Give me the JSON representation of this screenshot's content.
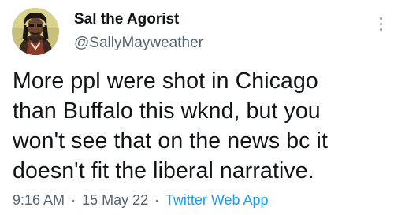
{
  "author": {
    "name": "Sal the Agorist",
    "handle": "@SallyMayweather"
  },
  "tweet": {
    "lines": [
      "More ppl were shot in Chicago",
      "than Buffalo this wknd, but you",
      "won't see that on the news bc it",
      "doesn't fit the liberal narrative."
    ]
  },
  "meta": {
    "time": "9:16 AM",
    "separator": "·",
    "date": "15 May 22",
    "source": "Twitter Web App"
  },
  "icons": {
    "more": "more-options-icon"
  },
  "colors": {
    "text": "#0f1419",
    "secondary": "#536471",
    "link": "#1d9bf0"
  }
}
